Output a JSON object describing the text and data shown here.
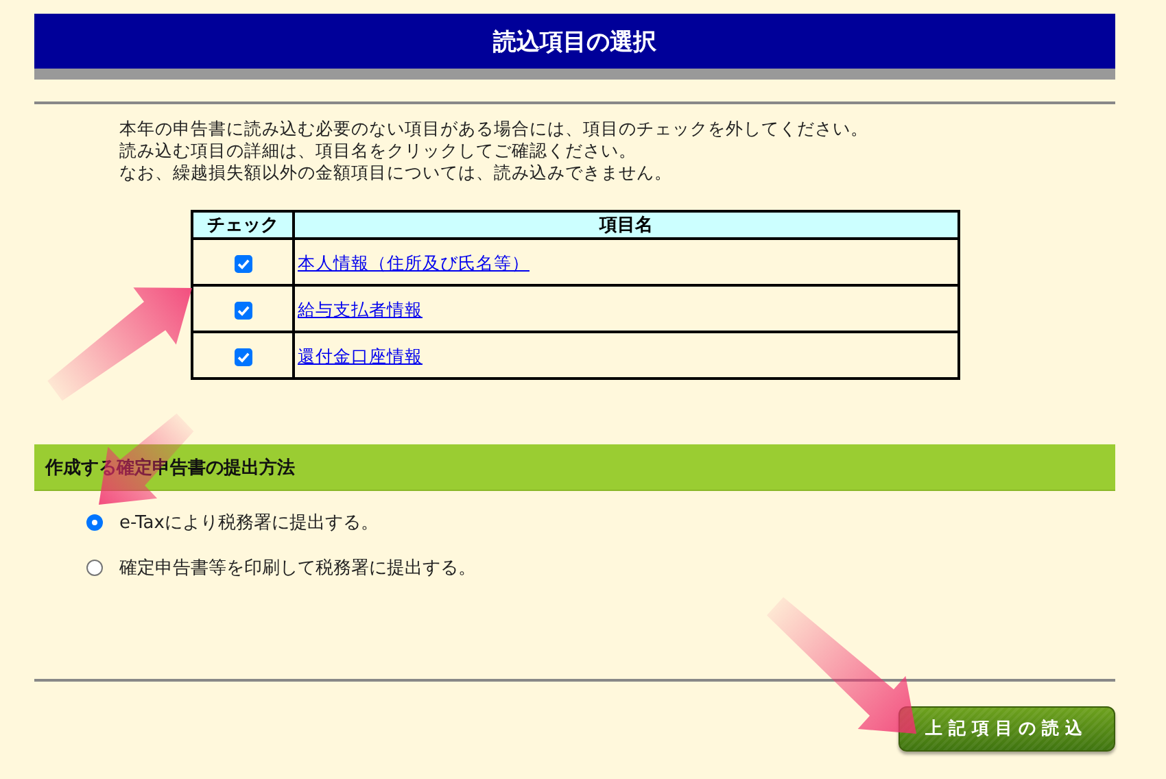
{
  "title": "読込項目の選択",
  "instructions": [
    "本年の申告書に読み込む必要のない項目がある場合には、項目のチェックを外してください。",
    "読み込む項目の詳細は、項目名をクリックしてご確認ください。",
    "なお、繰越損失額以外の金額項目については、読み込みできません。"
  ],
  "table": {
    "columns": [
      "チェック",
      "項目名"
    ],
    "rows": [
      {
        "checked": true,
        "name": "本人情報（住所及び氏名等）"
      },
      {
        "checked": true,
        "name": "給与支払者情報"
      },
      {
        "checked": true,
        "name": "還付金口座情報"
      }
    ]
  },
  "section": {
    "title": "作成する確定申告書の提出方法",
    "options": [
      {
        "label": "e-Taxにより税務署に提出する。",
        "selected": true
      },
      {
        "label": "確定申告書等を印刷して税務署に提出する。",
        "selected": false
      }
    ]
  },
  "button": "上記項目の読込"
}
